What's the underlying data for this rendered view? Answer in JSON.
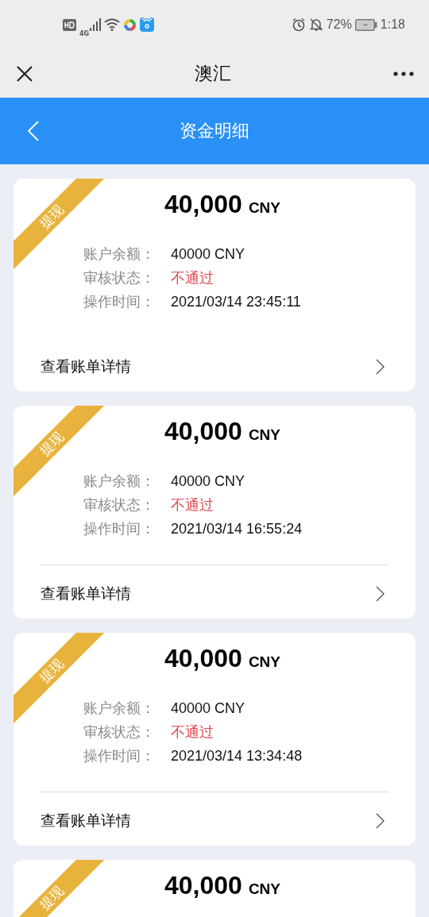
{
  "status_bar": {
    "network": "4G",
    "battery": "72%",
    "time": "1:18"
  },
  "app_bar": {
    "title": "澳汇"
  },
  "header": {
    "title": "资金明细"
  },
  "records": [
    {
      "tag": "提现",
      "amount": "40,000",
      "currency": "CNY",
      "fields": [
        {
          "label": "账户余额：",
          "value": "40000 CNY",
          "kind": "plain"
        },
        {
          "label": "审核状态：",
          "value": "不通过",
          "kind": "rejected"
        },
        {
          "label": "操作时间：",
          "value": "2021/03/14 23:45:11",
          "kind": "plain"
        }
      ],
      "divider": false,
      "link": "查看账单详情"
    },
    {
      "tag": "提现",
      "amount": "40,000",
      "currency": "CNY",
      "fields": [
        {
          "label": "账户余额：",
          "value": "40000 CNY",
          "kind": "plain"
        },
        {
          "label": "审核状态：",
          "value": "不通过",
          "kind": "rejected"
        },
        {
          "label": "操作时间：",
          "value": "2021/03/14 16:55:24",
          "kind": "plain"
        }
      ],
      "divider": true,
      "link": "查看账单详情"
    },
    {
      "tag": "提现",
      "amount": "40,000",
      "currency": "CNY",
      "fields": [
        {
          "label": "账户余额：",
          "value": "40000 CNY",
          "kind": "plain"
        },
        {
          "label": "审核状态：",
          "value": "不通过",
          "kind": "rejected"
        },
        {
          "label": "操作时间：",
          "value": "2021/03/14 13:34:48",
          "kind": "plain"
        }
      ],
      "divider": true,
      "link": "查看账单详情"
    },
    {
      "tag": "提现",
      "amount": "40,000",
      "currency": "CNY"
    }
  ]
}
